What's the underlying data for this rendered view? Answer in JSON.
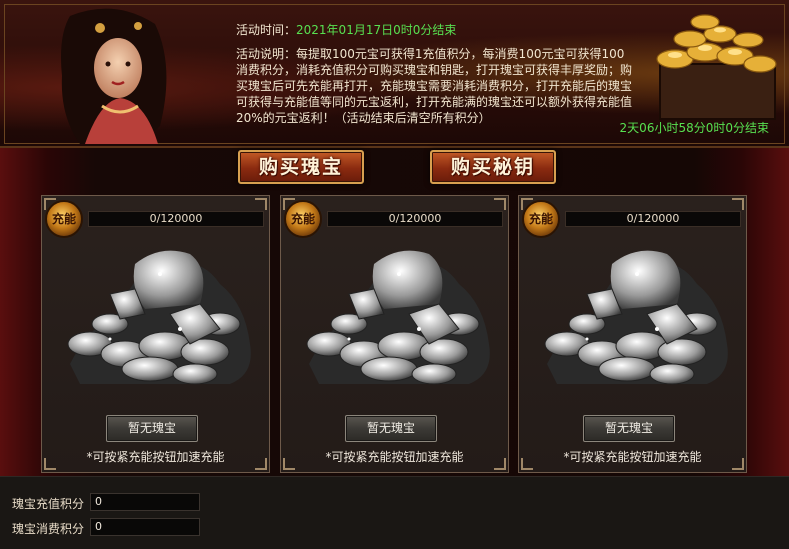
{
  "banner": {
    "time_label": "活动时间：",
    "time_value": "2021年01月17日0时0分结束",
    "desc_label": "活动说明：",
    "description": "每提取100元宝可获得1充值积分，每消费100元宝可获得100消费积分，消耗充值积分可购买瑰宝和钥匙，打开瑰宝可获得丰厚奖励；购买瑰宝后可先充能再打开，充能瑰宝需要消耗消费积分，打开充能后的瑰宝可获得与充能值等同的元宝返利，打开充能满的瑰宝还可以额外获得充能值20%的元宝返利！（活动结束后清空所有积分）",
    "countdown": "2天06小时58分0时0分结束"
  },
  "buttons": {
    "buy_treasure": "购买瑰宝",
    "buy_key": "购买秘钥"
  },
  "panels": [
    {
      "badge": "充能",
      "progress_text": "0/120000",
      "progress": 0,
      "button": "暂无瑰宝",
      "hint": "*可按紧充能按钮加速充能"
    },
    {
      "badge": "充能",
      "progress_text": "0/120000",
      "progress": 0,
      "button": "暂无瑰宝",
      "hint": "*可按紧充能按钮加速充能"
    },
    {
      "badge": "充能",
      "progress_text": "0/120000",
      "progress": 0,
      "button": "暂无瑰宝",
      "hint": "*可按紧充能按钮加速充能"
    }
  ],
  "scores": {
    "recharge_label": "瑰宝充值积分",
    "recharge_value": "0",
    "consume_label": "瑰宝消费积分",
    "consume_value": "0"
  }
}
